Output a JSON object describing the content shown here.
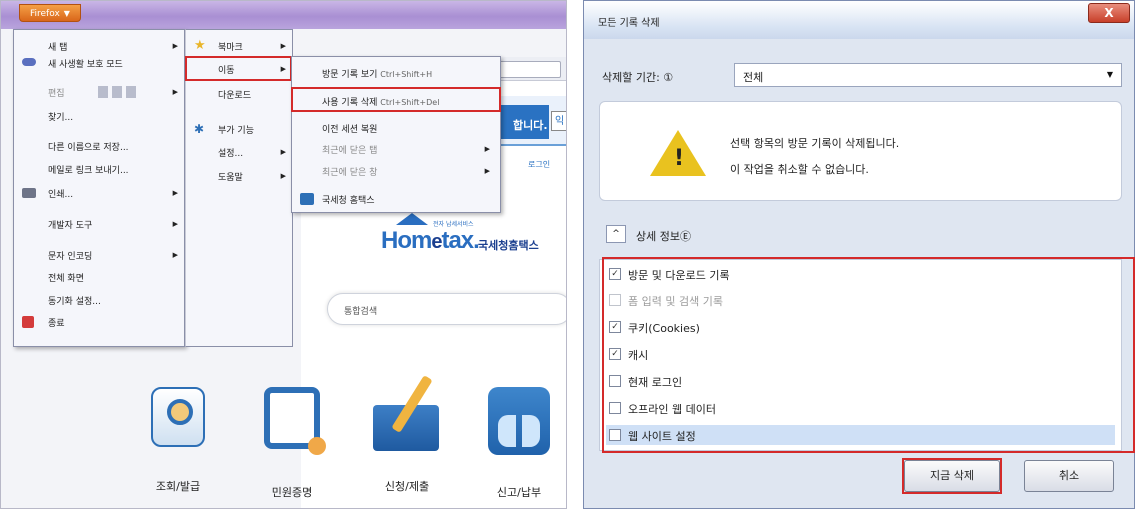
{
  "firefox_button": {
    "label": "Firefox",
    "caret": "▼"
  },
  "main_menu": {
    "items": [
      {
        "label": "새 탭",
        "arrow": "▶"
      },
      {
        "label": "새 사생활 보호 모드",
        "arrow": ""
      },
      {
        "label": "편집",
        "arrow": "▶"
      },
      {
        "label": "찾기...",
        "arrow": ""
      },
      {
        "label": "다른 이름으로 저장...",
        "arrow": ""
      },
      {
        "label": "메일로 링크 보내기...",
        "arrow": ""
      },
      {
        "label": "인쇄...",
        "arrow": "▶"
      },
      {
        "label": "개발자 도구",
        "arrow": "▶"
      },
      {
        "label": "문자 인코딩",
        "arrow": "▶"
      },
      {
        "label": "전체 화면",
        "arrow": ""
      },
      {
        "label": "동기화 설정...",
        "arrow": ""
      },
      {
        "label": "종료",
        "arrow": ""
      }
    ]
  },
  "sub_menu_1": {
    "items": [
      {
        "label": "북마크",
        "arrow": "▶"
      },
      {
        "label": "이동",
        "arrow": "▶"
      },
      {
        "label": "다운로드",
        "arrow": ""
      },
      {
        "label": "부가 기능",
        "arrow": ""
      },
      {
        "label": "설정...",
        "arrow": "▶"
      },
      {
        "label": "도움말",
        "arrow": "▶"
      }
    ]
  },
  "sub_menu_2": {
    "items": [
      {
        "label": "방문 기록 보기",
        "shortcut": "Ctrl+Shift+H",
        "arrow": ""
      },
      {
        "label": "사용 기록 삭제",
        "shortcut": "Ctrl+Shift+Del",
        "arrow": ""
      },
      {
        "label": "이전 세션 복원",
        "shortcut": "",
        "arrow": ""
      },
      {
        "label": "최근에 닫은 탭",
        "shortcut": "",
        "arrow": "▶"
      },
      {
        "label": "최근에 닫은 창",
        "shortcut": "",
        "arrow": "▶"
      },
      {
        "label": "국세청 홈택스",
        "shortcut": "",
        "arrow": ""
      }
    ]
  },
  "website": {
    "greeting": "합니다.",
    "greeting_box": "익",
    "login": "로그인",
    "logo_main": "Hom",
    "logo_e": "e",
    "logo_tail": "tax.",
    "logo_sub": "국세청홈택스",
    "logo_tag": "전자 납세서비스",
    "search_placeholder": "통합검색",
    "services": [
      "조회/발급",
      "민원증명",
      "신청/제출",
      "신고/납부"
    ]
  },
  "dialog": {
    "title": "모든 기록 삭제",
    "close": "X",
    "period_label": "삭제할 기간: ①",
    "period_value": "전체",
    "warning_line1": "선택 항목의 방문 기록이 삭제됩니다.",
    "warning_line2": "이 작업을 취소할 수 없습니다.",
    "details_toggle": "^",
    "details_label": "상세 정보Ⓔ",
    "checks": [
      {
        "label": "방문 및 다운로드 기록",
        "checked": true,
        "disabled": false
      },
      {
        "label": "폼 입력 및 검색 기록",
        "checked": false,
        "disabled": true
      },
      {
        "label": "쿠키(Cookies)",
        "checked": true,
        "disabled": false
      },
      {
        "label": "캐시",
        "checked": true,
        "disabled": false
      },
      {
        "label": "현재 로그인",
        "checked": false,
        "disabled": false
      },
      {
        "label": "오프라인 웹 데이터",
        "checked": false,
        "disabled": false
      },
      {
        "label": "웹 사이트 설정",
        "checked": false,
        "disabled": false
      }
    ],
    "clear_button": "지금 삭제",
    "cancel_button": "취소",
    "check_mark": "✓"
  },
  "colors": {
    "highlight_red": "#d42a2a",
    "firefox_orange": "#e07a2a",
    "warning_yellow": "#e9c21f"
  }
}
